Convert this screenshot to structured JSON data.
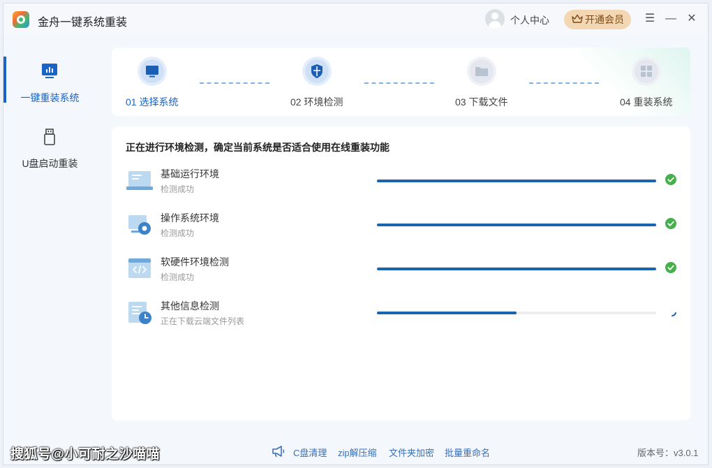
{
  "app": {
    "title": "金舟一键系统重装"
  },
  "header": {
    "user_center": "个人中心",
    "vip_label": "开通会员"
  },
  "window_controls": {
    "menu": "☰",
    "minimize": "—",
    "close": "✕"
  },
  "sidebar": {
    "items": [
      {
        "label": "一键重装系统",
        "icon": "monitor-chart-icon",
        "active": true
      },
      {
        "label": "U盘启动重装",
        "icon": "usb-drive-icon",
        "active": false
      }
    ]
  },
  "steps": [
    {
      "label": "01 选择系统",
      "icon": "monitor-icon",
      "state": "active"
    },
    {
      "label": "02 环境检测",
      "icon": "shield-icon",
      "state": "active"
    },
    {
      "label": "03 下载文件",
      "icon": "folder-icon",
      "state": "pending"
    },
    {
      "label": "04 重装系统",
      "icon": "windows-icon",
      "state": "pending"
    }
  ],
  "main": {
    "heading": "正在进行环境检测，确定当前系统是否适合使用在线重装功能",
    "checks": [
      {
        "name": "基础运行环境",
        "status": "检测成功",
        "progress": 1.0,
        "done": true,
        "icon": "laptop-icon"
      },
      {
        "name": "操作系统环境",
        "status": "检测成功",
        "progress": 1.0,
        "done": true,
        "icon": "os-gear-icon"
      },
      {
        "name": "软硬件环境检测",
        "status": "检测成功",
        "progress": 1.0,
        "done": true,
        "icon": "code-window-icon"
      },
      {
        "name": "其他信息检测",
        "status": "正在下载云端文件列表",
        "progress": 0.5,
        "done": false,
        "icon": "document-clock-icon"
      }
    ]
  },
  "footer": {
    "tools": [
      "C盘清理",
      "zip解压缩",
      "文件夹加密",
      "批量重命名"
    ],
    "version": "版本号：v3.0.1",
    "watermark": "搜狐号@小可耐之沙喵喵"
  },
  "colors": {
    "accent": "#1a64b0",
    "success": "#45b04c",
    "vip": "#f3d7b3"
  }
}
